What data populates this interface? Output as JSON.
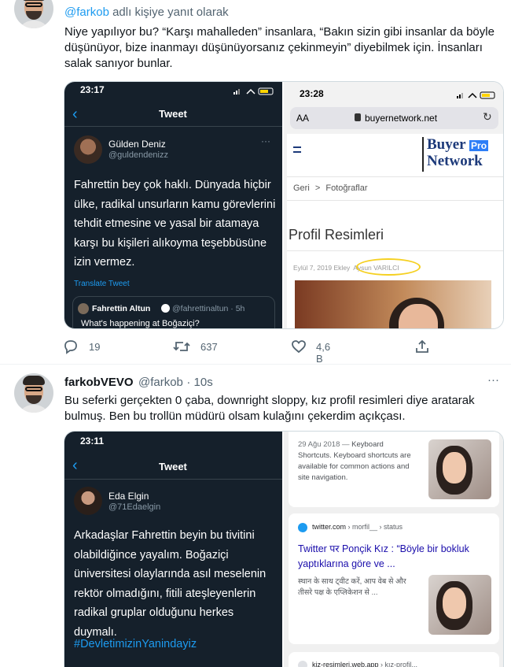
{
  "tweet1": {
    "reply_prefix_mention": "@farkob",
    "reply_prefix_text": "adlı kişiye yanıt olarak",
    "text": "Niye yapılıyor bu? “Karşı mahalleden” insanlara, “Bakın sizin gibi insanlar da böyle düşünüyor, bize inanmayı düşünüyorsanız çekinmeyin” diyebilmek için. İnsanları salak sanıyor bunlar.",
    "left_shot": {
      "time": "23:17",
      "header": "Tweet",
      "author_name": "Gülden Deniz",
      "author_handle": "@guldendenizz",
      "more": "···",
      "text": "Fahrettin bey çok haklı. Dünyada hiçbir ülke, radikal unsurların kamu görevlerini tehdit etmesine ve yasal bir atamaya karşı bu kişileri alıkoyma teşebbüsüne izin vermez.",
      "translate": "Translate Tweet",
      "quote_name": "Fahrettin Altun",
      "quote_handle": "@fahrettinaltun · 5h",
      "quote_text": "What's happening at Boğaziçi?"
    },
    "right_shot": {
      "time": "23:28",
      "aa": "AA",
      "url": "buyernetwork.net",
      "logo_word1": "Buyer",
      "logo_pro": "Pro",
      "logo_word2": "Network",
      "breadcrumb_home": "Geri",
      "breadcrumb_sep": ">",
      "breadcrumb_page": "Fotoğraflar",
      "heading": "Profil Resimleri",
      "meta_date": "Eylül 7, 2019 Ekley",
      "meta_author": "Aysun VARILCI"
    },
    "actions": {
      "replies": "19",
      "retweets": "637",
      "likes": "4,6 B"
    }
  },
  "tweet2": {
    "name": "farkobVEVO",
    "handle": "@farkob",
    "time": "· 10s",
    "more": "···",
    "text": "Bu seferki gerçekten 0 çaba, downright sloppy, kız profil resimleri diye aratarak bulmuş. Ben bu trollün müdürü olsam kulağını çekerdim açıkçası.",
    "left_shot": {
      "time": "23:11",
      "header": "Tweet",
      "author_name": "Eda Elgin",
      "author_handle": "@71Edaelgin",
      "text": "Arkadaşlar Fahrettin beyin bu tivitini olabildiğince yayalım. Boğaziçi üniversitesi olaylarında asıl meselenin rektör olmadığını, fitili ateşleyenlerin radikal gruplar olduğunu herkes duymalı.",
      "hashtag": "#DevletimizinYanindayiz"
    },
    "right_shot": {
      "result1_date": "29 Ağu 2018 —",
      "result1_head": "Keyboard",
      "result1_body": "Shortcuts. Keyboard shortcuts are available for common actions and site navigation.",
      "result2_source": "twitter.com",
      "result2_path": "› morfil__ › status",
      "result2_title": "Twitter पर Ponçik Kız : “Böyle bir bokluk yaptıklarına göre ve ...",
      "result2_snippet": "स्थान के साथ ट्वीट करें, आप वेब से और तीसरे पक्ष के एप्लिकेशन से ...",
      "result3_source": "kiz-resimleri.web.app",
      "result3_path": "› kız-profil..."
    }
  }
}
